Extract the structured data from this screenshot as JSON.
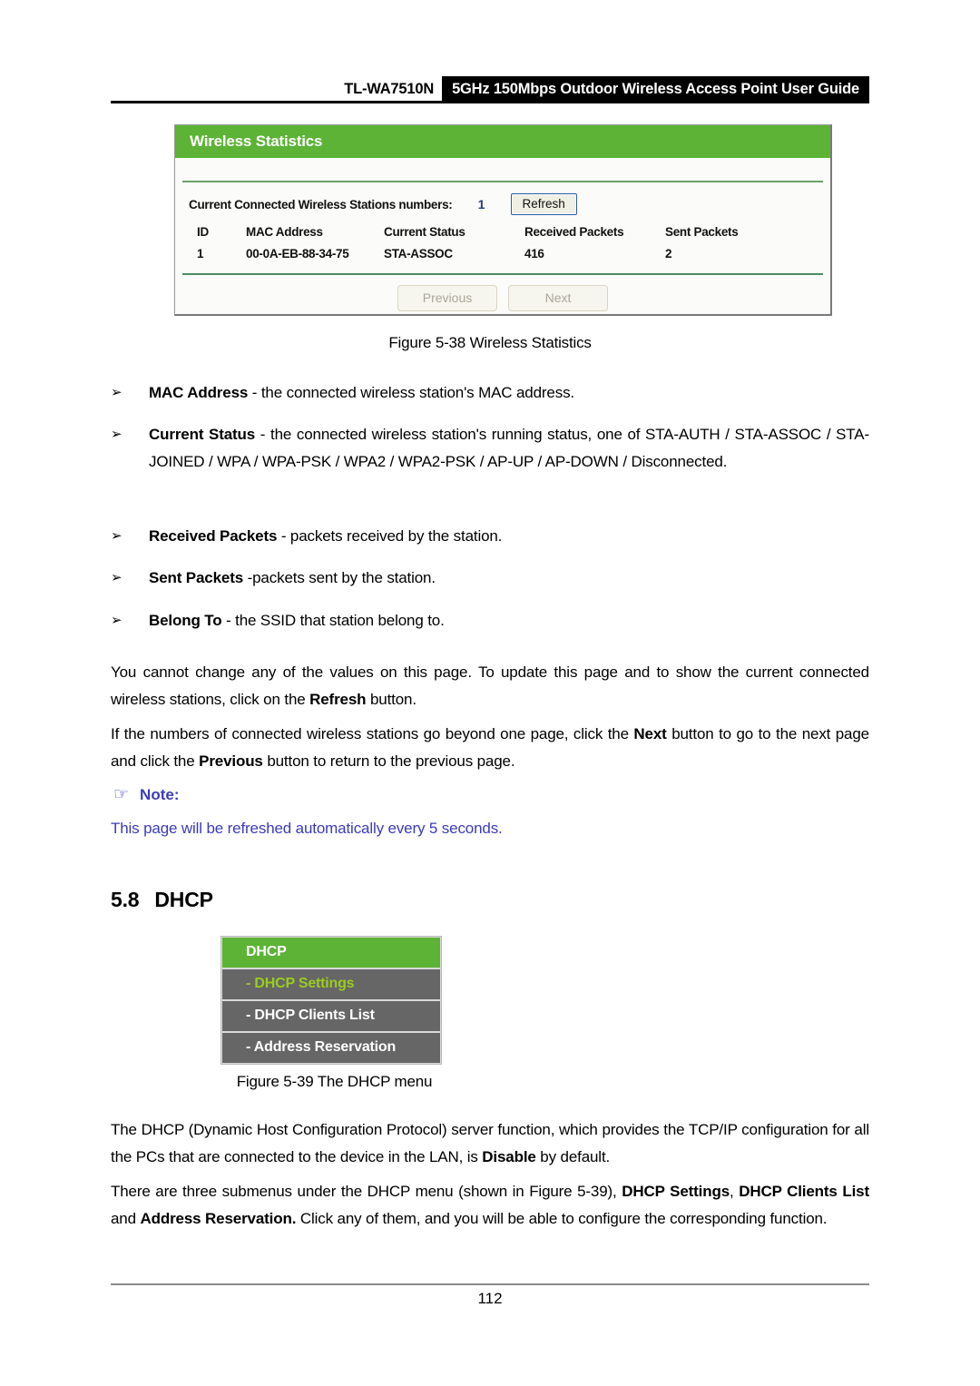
{
  "header": {
    "model": "TL-WA7510N",
    "guide_title": "5GHz 150Mbps Outdoor Wireless Access Point User Guide"
  },
  "wireless_statistics_panel": {
    "title": "Wireless Statistics",
    "count_label": "Current Connected Wireless Stations numbers:",
    "count_value": "1",
    "refresh_label": "Refresh",
    "columns": [
      "ID",
      "MAC Address",
      "Current Status",
      "Received Packets",
      "Sent Packets"
    ],
    "rows": [
      {
        "id": "1",
        "mac": "00-0A-EB-88-34-75",
        "status": "STA-ASSOC",
        "received": "416",
        "sent": "2"
      }
    ],
    "previous_label": "Previous",
    "next_label": "Next",
    "accent_green": "#5cb335",
    "count_blue": "#1b3f8b"
  },
  "figure_538_caption": "Figure 5-38 Wireless Statistics",
  "bullets": [
    {
      "marker": "➢",
      "term": "MAC Address",
      "rest": " - the connected wireless station's MAC address."
    },
    {
      "marker": "➢",
      "term": "Current Status",
      "rest": " - the connected wireless station's running status, one of STA-AUTH / STA-ASSOC / STA-JOINED / WPA / WPA-PSK / WPA2 / WPA2-PSK / AP-UP / AP-DOWN / Disconnected."
    },
    {
      "marker": "➢",
      "term": "Received Packets",
      "rest": " - packets received by the station."
    },
    {
      "marker": "➢",
      "term": "Sent Packets",
      "rest": " -packets sent by the station."
    },
    {
      "marker": "➢",
      "term": "Belong To",
      "rest": " - the SSID that station belong to."
    }
  ],
  "paragraph_refresh": {
    "part1": "You cannot change any of the values on this page. To update this page and to show the current connected wireless stations, click on the ",
    "bold1": "Refresh",
    "part2": " button."
  },
  "paragraph_paging": {
    "part1": "If the numbers of connected wireless stations go beyond one page, click the ",
    "bold1": "Next",
    "part2": " button to go to the next page and click the ",
    "bold2": "Previous",
    "part3": " button to return to the previous page."
  },
  "note": {
    "hand_icon": "☞",
    "label": "Note:",
    "text": "This page will be refreshed automatically every 5 seconds.",
    "color": "#3b3bbb"
  },
  "section": {
    "number": "5.8",
    "title": "DHCP"
  },
  "dhcp_menu": {
    "header": "DHCP",
    "items": [
      {
        "label": "- DHCP Settings",
        "active": true
      },
      {
        "label": "- DHCP Clients List",
        "active": false
      },
      {
        "label": "- Address Reservation",
        "active": false
      }
    ],
    "header_green": "#5cb335",
    "item_grey": "#666666",
    "active_text": "#9acd20"
  },
  "figure_539_caption": "Figure 5-39 The DHCP menu",
  "paragraph_dhcp_intro": {
    "part1": "The DHCP (Dynamic Host Configuration Protocol) server function, which provides the TCP/IP configuration for all the PCs that are connected to the device in the LAN, is ",
    "bold1": "Disable",
    "part2": " by default."
  },
  "paragraph_dhcp_submenus": {
    "part1": "There are three submenus under the DHCP menu (shown in Figure 5-39), ",
    "bold1": "DHCP Settings",
    "part2": ", ",
    "bold2": "DHCP Clients List",
    "part3": " and ",
    "bold3": "Address Reservation.",
    "part4": " Click any of them, and you will be able to configure the corresponding function."
  },
  "footer": {
    "page_number": "112"
  }
}
